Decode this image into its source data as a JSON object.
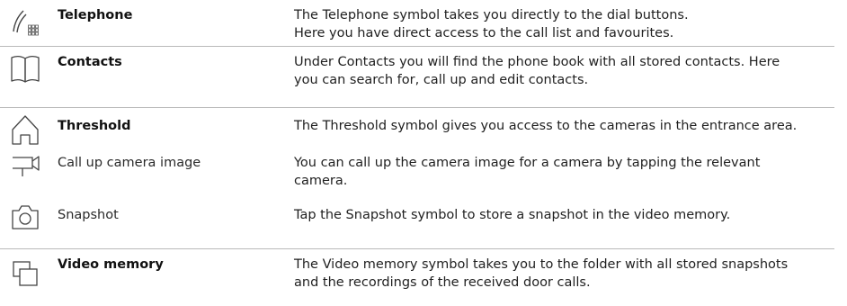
{
  "rows": [
    {
      "label": "Telephone",
      "bold": true,
      "icon": "telephone-handset-keypad-icon",
      "desc": [
        "The Telephone symbol takes you directly to the dial buttons.",
        "Here you have direct access to the call list and favourites."
      ]
    },
    {
      "label": "Contacts",
      "bold": true,
      "icon": "open-book-icon",
      "desc": [
        "Under Contacts you will find the phone book with all stored contacts. Here",
        "you can search for, call up and edit contacts."
      ]
    },
    {
      "label": "Threshold",
      "bold": true,
      "icon": "house-icon",
      "desc": [
        "The Threshold symbol gives you access to the cameras in the entrance area."
      ]
    },
    {
      "label": "Call up camera image",
      "bold": false,
      "icon": "video-camera-icon",
      "desc": [
        "You can call up the camera image for a camera by tapping the relevant",
        "camera."
      ]
    },
    {
      "label": "Snapshot",
      "bold": false,
      "icon": "camera-icon",
      "desc": [
        "Tap the Snapshot symbol to store a snapshot in the video memory."
      ]
    },
    {
      "label": "Video memory",
      "bold": true,
      "icon": "overlapping-frames-icon",
      "desc": [
        "The Video memory symbol takes you to the folder with all stored snapshots",
        "and the recordings of the received door calls."
      ]
    }
  ]
}
